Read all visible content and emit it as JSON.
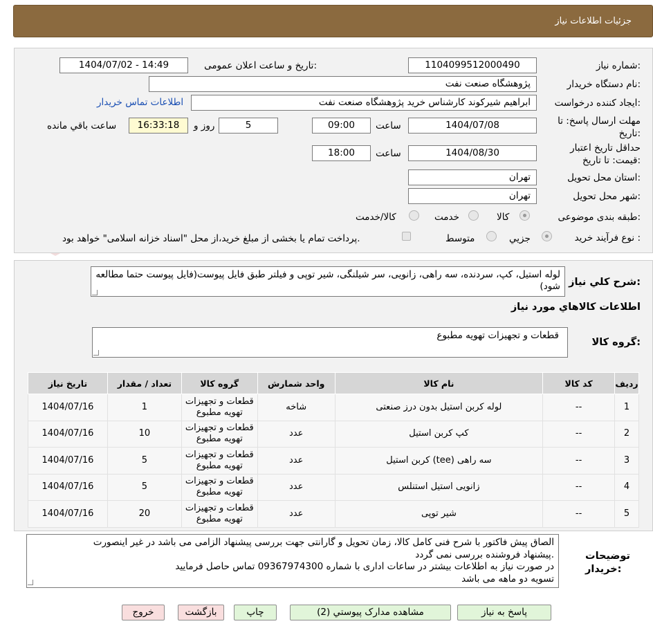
{
  "header": {
    "title": "جزئیات اطلاعات نیاز"
  },
  "form": {
    "need_number_label": "شماره نیاز:",
    "need_number": "1104099512000490",
    "announce_label": "تاریخ و ساعت اعلان عمومی:",
    "announce_value": "1404/07/02 - 14:49",
    "buyer_org_label": "نام دستگاه خریدار:",
    "buyer_org": "پژوهشگاه صنعت نفت",
    "requester_label": "ایجاد کننده درخواست:",
    "requester": "ابراهیم شیرکوند کارشناس خرید پژوهشگاه صنعت نفت",
    "contact_link": "اطلاعات تماس خریدار",
    "reply_deadline_label": "مهلت ارسال پاسخ: تا تاریخ:",
    "reply_date": "1404/07/08",
    "time_label": "ساعت",
    "reply_time": "09:00",
    "days_value": "5",
    "days_label": "روز و",
    "remaining_time": "16:33:18",
    "remaining_label": "ساعت باقي مانده",
    "price_validity_label": "حداقل تاریخ اعتبار قیمت: تا تاریخ:",
    "validity_date": "1404/08/30",
    "validity_time": "18:00",
    "province_label": "استان محل تحویل:",
    "province": "تهران",
    "city_label": "شهر محل تحویل:",
    "city": "تهران",
    "category_label": "طبقه بندی موضوعی:",
    "category_options": [
      "کالا",
      "خدمت",
      "کالا/خدمت"
    ],
    "process_label": "نوع فرآیند خرید :",
    "process_options": [
      "جزیي",
      "متوسط"
    ],
    "process_note": "پرداخت تمام یا بخشی از مبلغ خرید،از محل \"اسناد خزانه اسلامی\" خواهد بود."
  },
  "summary": {
    "label": "شرح کلي نیاز:",
    "text": "لوله استیل، کپ، سردنده، سه راهی، زانویی، سر شیلنگی، شیر توپی و فیلتر طبق فایل پیوست(فایل پیوست حتما مطالعه شود)"
  },
  "goods": {
    "section_title": "اطلاعات کالاهاي مورد نياز",
    "group_label": "گروه کالا:",
    "group_value": "قطعات و تجهیزات تهویه مطبوع"
  },
  "table": {
    "headers": [
      "ردیف",
      "کد کالا",
      "نام کالا",
      "واحد شمارش",
      "گروه کالا",
      "تعداد / مقدار",
      "تاریخ نیاز"
    ],
    "rows": [
      [
        "1",
        "--",
        "لوله کربن استیل بدون درز صنعتی",
        "شاخه",
        "قطعات و تجهیزات تهویه مطبوع",
        "1",
        "1404/07/16"
      ],
      [
        "2",
        "--",
        "کپ کربن استیل",
        "عدد",
        "قطعات و تجهیزات تهویه مطبوع",
        "10",
        "1404/07/16"
      ],
      [
        "3",
        "--",
        "سه راهی (tee) کربن استیل",
        "عدد",
        "قطعات و تجهیزات تهویه مطبوع",
        "5",
        "1404/07/16"
      ],
      [
        "4",
        "--",
        "زانویی استیل استنلس",
        "عدد",
        "قطعات و تجهیزات تهویه مطبوع",
        "5",
        "1404/07/16"
      ],
      [
        "5",
        "--",
        "شیر توپی",
        "عدد",
        "قطعات و تجهیزات تهویه مطبوع",
        "20",
        "1404/07/16"
      ]
    ]
  },
  "notes": {
    "label": "توضیحات خریدار:",
    "lines": [
      "الصاق پیش فاکتور با شرح فنی کامل کالا، زمان تحویل و گارانتی جهت بررسی پیشنهاد الزامی می باشد در غیر اینصورت",
      "پیشنهاد فروشنده بررسی نمی گردد.",
      "در صورت نیاز به اطلاعات بیشتر در ساعات اداری با شماره 09367974300 تماس حاصل فرمایید",
      "تسویه دو ماهه می باشد"
    ]
  },
  "buttons": {
    "reply": "پاسخ به نیاز",
    "attachments": "مشاهده مدارک پیوستي (2)",
    "print": "چاپ",
    "back": "بازگشت",
    "exit": "خروج"
  },
  "watermark": {
    "text": "AriaTender.neT"
  },
  "colors": {
    "header_bg": "#8b6a3f",
    "panel_bg": "#f2f2f2",
    "table_header": "#d6d6d6",
    "link": "#1a4fb3"
  }
}
